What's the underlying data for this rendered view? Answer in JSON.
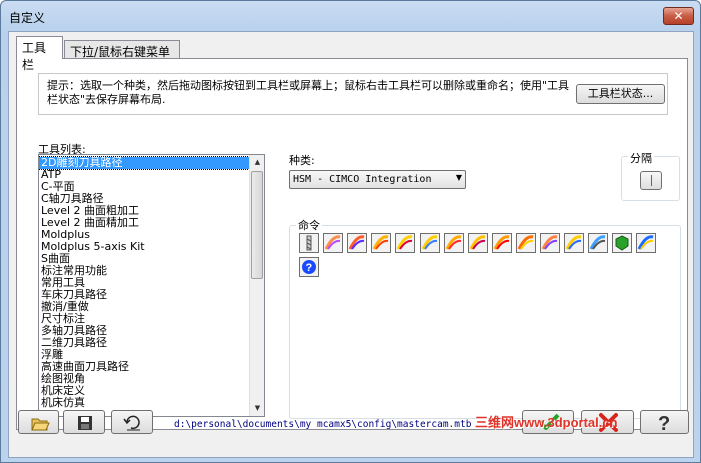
{
  "window": {
    "title": "自定义",
    "close_glyph": "✕"
  },
  "tabs": [
    {
      "label": "工具栏",
      "active": true
    },
    {
      "label": "下拉/鼠标右键菜单",
      "active": false
    }
  ],
  "hint": {
    "text": "提示：选取一个种类，然后拖动图标按钮到工具栏或屏幕上；鼠标右击工具栏可以删除或重命名；使用\"工具栏状态\"去保存屏幕布局.",
    "toolbar_state_button": "工具栏状态..."
  },
  "toolbar_list": {
    "label": "工具列表:",
    "items": [
      "2D雕刻刀具路径",
      "ATP",
      "C-平面",
      "C轴刀具路径",
      "Level 2 曲面粗加工",
      "Level 2 曲面精加工",
      "Moldplus",
      "Moldplus 5-axis Kit",
      "S曲面",
      "标注常用功能",
      "常用工具",
      "车床刀具路径",
      "撤消/重做",
      "尺寸标注",
      "多轴刀具路径",
      "二维刀具路径",
      "浮雕",
      "高速曲面刀具路径",
      "绘图视角",
      "机床定义",
      "机床仿真"
    ],
    "selected_index": 0
  },
  "category": {
    "label": "种类:",
    "selected": "HSM - CIMCO Integration"
  },
  "separator": {
    "label": "分隔"
  },
  "commands": {
    "label": "命令",
    "icons": [
      "drill-icon",
      "hsm-roughing-icon",
      "hsm-contour-icon",
      "hsm-finish-icon",
      "hsm-parallel-icon",
      "hsm-flat-icon",
      "hsm-scallop-icon",
      "hsm-pencil-icon",
      "hsm-rest-icon",
      "hsm-radial-icon",
      "hsm-spiral-icon",
      "hsm-morph-icon",
      "simulation-icon",
      "stock-cube-icon",
      "tool-setting-icon",
      "help-icon"
    ]
  },
  "footer": {
    "path": "d:\\personal\\documents\\my mcamx5\\config\\mastercam.mtb",
    "open_icon": "folder-open-icon",
    "save_icon": "save-disk-icon",
    "reset_icon": "undo-arrow-icon",
    "ok_icon": "check-icon",
    "cancel_icon": "cross-icon",
    "help_icon": "help-question-icon"
  },
  "watermark": "三维网www.3dportal.cn",
  "colors": {
    "selection": "#3399ff",
    "ok_green": "#2aa12a",
    "cancel_red": "#d8261c",
    "path_text": "#000080"
  }
}
